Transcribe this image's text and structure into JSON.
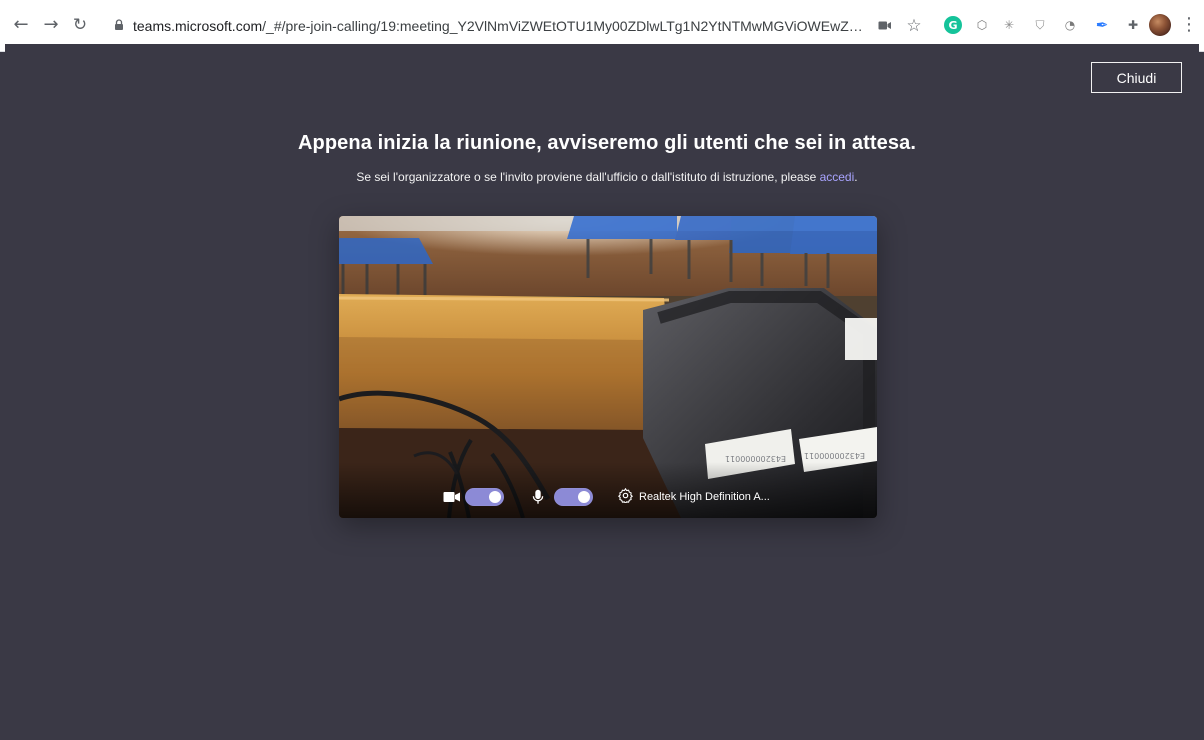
{
  "browser": {
    "url_host": "teams.microsoft.com",
    "url_path": "/_#/pre-join-calling/19:meeting_Y2VlNmViZWEtOTU1My00ZDlwLTg1N2YtNTMwMGViOWEwZDBl@th...",
    "icons": {
      "back": "back-arrow-icon",
      "forward": "forward-arrow-icon",
      "reload": "reload-icon",
      "lock": "lock-icon",
      "camera": "camera-icon",
      "star": "star-icon",
      "grammarly": "grammarly-icon",
      "dropbox": "dropbox-icon",
      "snowflake": "snowflake-icon",
      "shield": "shield-icon",
      "circle": "circle-icon",
      "feather": "feather-icon",
      "puzzle": "puzzle-icon",
      "menu": "menu-icon"
    }
  },
  "page": {
    "close_label": "Chiudi",
    "headline": "Appena inizia la riunione, avviseremo gli utenti che sei in attesa.",
    "subtext_prefix": "Se sei l'organizzatore o se l'invito proviene dall'ufficio o dall'istituto di istruzione, please ",
    "subtext_link": "accedi",
    "subtext_suffix": ".",
    "video": {
      "camera_enabled": true,
      "microphone_enabled": true,
      "device_label": "Realtek High Definition A...",
      "icons": {
        "camera": "camera-icon",
        "microphone": "microphone-icon",
        "settings": "settings-icon"
      },
      "colors": {
        "toggle_on": "#8c8ad6"
      }
    }
  },
  "colors": {
    "page_background": "#3a3945",
    "link": "#a9a4ff",
    "text": "#ffffff"
  }
}
